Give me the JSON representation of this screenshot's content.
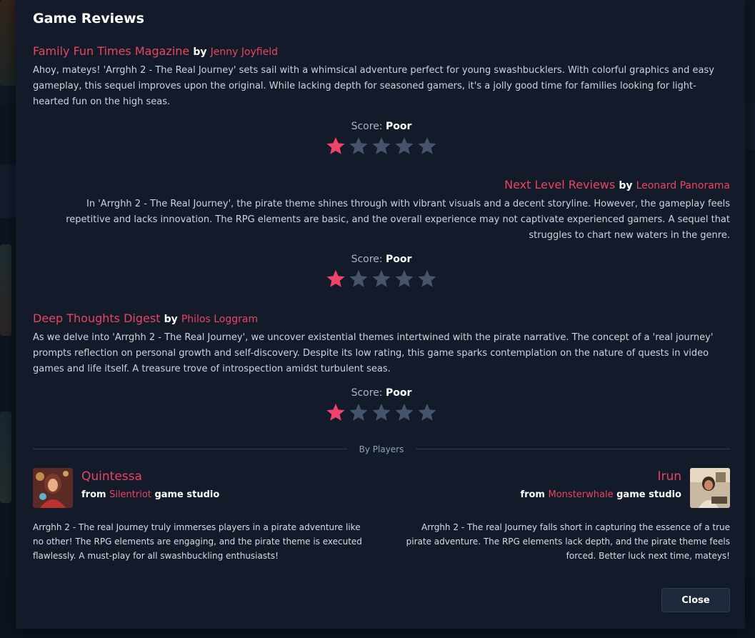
{
  "modal": {
    "title": "Game Reviews",
    "close_label": "Close"
  },
  "score_label": "Score:",
  "critic_reviews": [
    {
      "outlet": "Family Fun Times Magazine",
      "by": "by",
      "author": "Jenny Joyfield",
      "text": "Ahoy, mateys! 'Arrghh 2 - The Real Journey' sets sail with a whimsical adventure perfect for young swashbucklers. With colorful graphics and easy gameplay, this sequel improves upon the original. While lacking depth for seasoned gamers, it's a jolly good time for families looking for light-hearted fun on the high seas.",
      "score": "Poor",
      "stars_filled": 1,
      "stars_total": 5
    },
    {
      "outlet": "Next Level Reviews",
      "by": "by",
      "author": "Leonard Panorama",
      "text": "In 'Arrghh 2 - The Real Journey', the pirate theme shines through with vibrant visuals and a decent storyline. However, the gameplay feels repetitive and lacks innovation. The RPG elements are basic, and the overall experience may not captivate experienced gamers. A sequel that struggles to chart new waters in the genre.",
      "score": "Poor",
      "stars_filled": 1,
      "stars_total": 5
    },
    {
      "outlet": "Deep Thoughts Digest",
      "by": "by",
      "author": "Philos Loggram",
      "text": "As we delve into 'Arrghh 2 - The Real Journey', we uncover existential themes intertwined with the pirate narrative. The concept of a 'real journey' prompts reflection on personal growth and self-discovery. Despite its low rating, this game sparks contemplation on the nature of quests in video games and life itself. A treasure trove of introspection amidst turbulent seas.",
      "score": "Poor",
      "stars_filled": 1,
      "stars_total": 5
    }
  ],
  "players_section_label": "By Players",
  "player_reviews": [
    {
      "name": "Quintessa",
      "from": "from",
      "studio": "Silentriot",
      "studio_suffix": "game studio",
      "text": "Arrghh 2 - The real Journey truly immerses players in a pirate adventure like no other! The RPG elements are engaging, and the pirate theme is executed flawlessly. A must-play for all swashbuckling enthusiasts!"
    },
    {
      "name": "Irun",
      "from": "from",
      "studio": "Monsterwhale",
      "studio_suffix": "game studio",
      "text": "Arrghh 2 - The real Journey falls short in capturing the essence of a true pirate adventure. The RPG elements lack depth, and the pirate theme feels forced. Better luck next time, mateys!"
    }
  ],
  "colors": {
    "accent": "#e8455f",
    "star_filled": "#f0436a",
    "star_empty": "#45546b",
    "modal_bg": "#131b2b"
  }
}
